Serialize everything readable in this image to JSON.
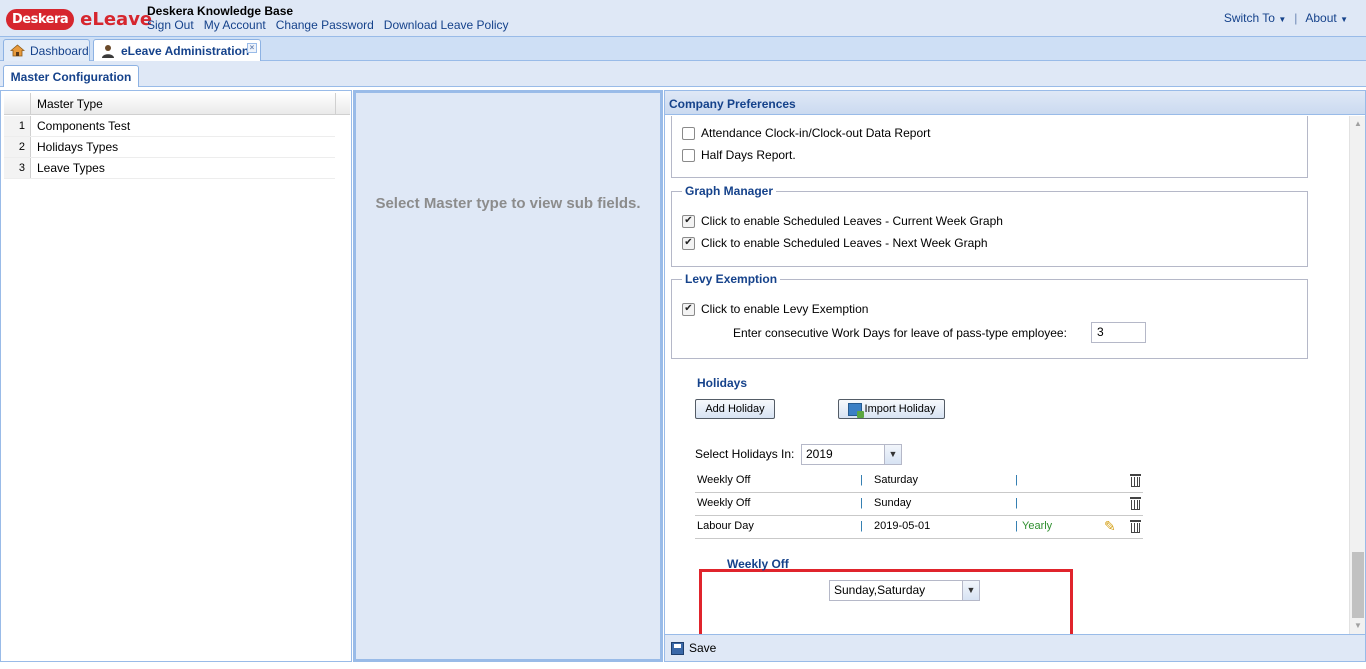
{
  "app": {
    "brand_badge": "Deskera",
    "product": "eLeave",
    "kb_title": "Deskera Knowledge Base",
    "nav": [
      "Sign Out",
      "My Account",
      "Change Password",
      "Download Leave Policy"
    ],
    "switch_to": "Switch To",
    "about": "About",
    "separator": "|"
  },
  "tabs": {
    "dashboard": "Dashboard",
    "admin": "eLeave Administration",
    "sub": "Master Configuration"
  },
  "master_grid": {
    "header": "Master Type",
    "rows": [
      {
        "num": "1",
        "label": "Components Test"
      },
      {
        "num": "2",
        "label": "Holidays Types"
      },
      {
        "num": "3",
        "label": "Leave Types"
      }
    ]
  },
  "middle": {
    "message": "Select Master type to view sub fields."
  },
  "prefs": {
    "title": "Company Preferences",
    "reports": [
      {
        "label": "Attendance Clock-in/Clock-out Data Report",
        "checked": false
      },
      {
        "label": "Half Days Report.",
        "checked": false
      }
    ],
    "graph_manager": {
      "legend": "Graph Manager",
      "items": [
        {
          "label": "Click to enable Scheduled Leaves - Current Week Graph",
          "checked": true
        },
        {
          "label": "Click to enable Scheduled Leaves - Next Week Graph",
          "checked": true
        }
      ]
    },
    "levy": {
      "legend": "Levy Exemption",
      "enable_label": "Click to enable Levy Exemption",
      "enable_checked": true,
      "days_label": "Enter consecutive Work Days for leave of pass-type employee:",
      "days_value": "3"
    },
    "holidays": {
      "title": "Holidays",
      "add_button": "Add Holiday",
      "import_button": "Import Holiday",
      "select_label": "Select Holidays In:",
      "year": "2019",
      "rows": [
        {
          "name": "Weekly Off",
          "sep1": "|",
          "value": "Saturday",
          "sep2": "|",
          "recurrence": ""
        },
        {
          "name": "Weekly Off",
          "sep1": "|",
          "value": "Sunday",
          "sep2": "|",
          "recurrence": ""
        },
        {
          "name": "Labour Day",
          "sep1": "|",
          "value": "2019-05-01",
          "sep2": "|",
          "recurrence": "Yearly"
        }
      ]
    },
    "weekly_off": {
      "title": "Weekly Off",
      "value": "Sunday,Saturday"
    },
    "save": "Save"
  },
  "colors": {
    "accent": "#15428b",
    "highlight": "#e0242c",
    "brand": "#d6262e"
  }
}
